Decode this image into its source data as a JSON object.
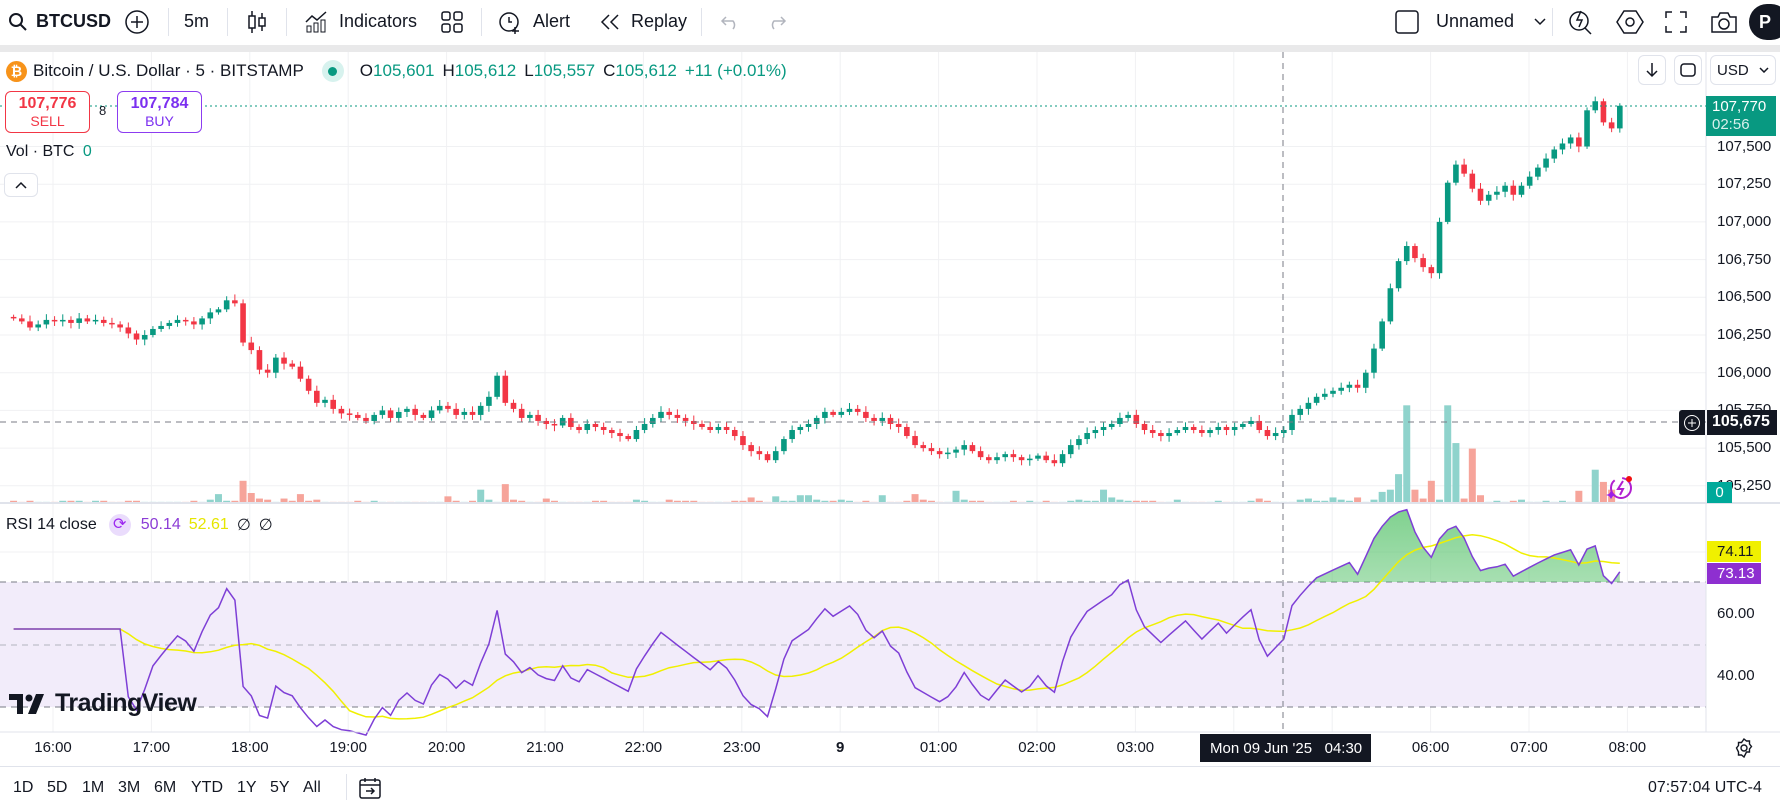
{
  "toolbar": {
    "symbol": "BTCUSD",
    "interval": "5m",
    "indicators": "Indicators",
    "alert": "Alert",
    "replay": "Replay",
    "layout_name": "Unnamed",
    "avatar": "P"
  },
  "legend": {
    "title": "Bitcoin / U.S. Dollar · 5 · BITSTAMP",
    "o_label": "O",
    "o": "105,601",
    "h_label": "H",
    "h": "105,612",
    "l_label": "L",
    "l": "105,557",
    "c_label": "C",
    "c": "105,612",
    "change": "+11 (+0.01%)"
  },
  "trade": {
    "sell_price": "107,776",
    "sell_label": "SELL",
    "spread": "8",
    "buy_price": "107,784",
    "buy_label": "BUY"
  },
  "volume_legend": {
    "label": "Vol · BTC",
    "value": "0"
  },
  "rsi_legend": {
    "label": "RSI 14 close",
    "rsi": "50.14",
    "ma": "52.61",
    "v1": "∅",
    "v2": "∅"
  },
  "price_axis": {
    "currency": "USD",
    "last_price": "107,770",
    "countdown": "02:56",
    "crosshair_price": "105,675",
    "volume_badge": "0",
    "ticks": [
      "107,500",
      "107,250",
      "107,000",
      "106,750",
      "106,500",
      "106,250",
      "106,000",
      "105,750",
      "105,500",
      "105,250"
    ]
  },
  "rsi_axis": {
    "ticks": [
      "60.00",
      "40.00"
    ],
    "ma_value": "74.11",
    "rsi_value": "73.13"
  },
  "time_axis": {
    "ticks": [
      "16:00",
      "17:00",
      "18:00",
      "19:00",
      "20:00",
      "21:00",
      "22:00",
      "23:00",
      "9",
      "01:00",
      "02:00",
      "03:00",
      "04:00",
      "05:00",
      "06:00",
      "07:00",
      "08:00"
    ],
    "crosshair_label": "Mon 09 Jun '25   04:30"
  },
  "ranges": [
    "1D",
    "5D",
    "1M",
    "3M",
    "6M",
    "YTD",
    "1Y",
    "5Y",
    "All"
  ],
  "clock": "07:57:04 UTC-4",
  "brand": "TradingView",
  "colors": {
    "up": "#089981",
    "down": "#f23645",
    "vol_up": "#8fd3cc",
    "vol_down": "#f6a49a",
    "rsi": "#7e3fd6",
    "rsi_ma": "#f0f000",
    "band": "#f2ecfa",
    "accent": "#2962ff"
  },
  "chart_data": {
    "type": "candlestick",
    "interval": "5m",
    "price_range": [
      105200,
      107850
    ],
    "first_label_time": "16:00",
    "closes": [
      106360,
      106340,
      106300,
      106320,
      106350,
      106340,
      106350,
      106330,
      106360,
      106340,
      106350,
      106330,
      106320,
      106300,
      106260,
      106220,
      106250,
      106290,
      106310,
      106330,
      106350,
      106340,
      106320,
      106360,
      106400,
      106420,
      106480,
      106460,
      106200,
      106150,
      106020,
      106000,
      106100,
      106060,
      106040,
      105960,
      105880,
      105800,
      105820,
      105760,
      105730,
      105720,
      105700,
      105680,
      105720,
      105750,
      105700,
      105740,
      105760,
      105720,
      105700,
      105750,
      105780,
      105760,
      105720,
      105740,
      105720,
      105780,
      105840,
      105980,
      105800,
      105760,
      105700,
      105720,
      105680,
      105660,
      105650,
      105700,
      105640,
      105620,
      105660,
      105640,
      105620,
      105600,
      105580,
      105560,
      105620,
      105660,
      105700,
      105740,
      105720,
      105700,
      105680,
      105660,
      105640,
      105620,
      105640,
      105620,
      105580,
      105520,
      105480,
      105460,
      105420,
      105480,
      105560,
      105620,
      105640,
      105660,
      105700,
      105740,
      105720,
      105740,
      105760,
      105740,
      105700,
      105680,
      105700,
      105660,
      105640,
      105580,
      105520,
      105500,
      105480,
      105460,
      105470,
      105490,
      105520,
      105480,
      105440,
      105420,
      105440,
      105460,
      105440,
      105420,
      105430,
      105450,
      105420,
      105400,
      105460,
      105520,
      105560,
      105600,
      105620,
      105640,
      105660,
      105700,
      105720,
      105660,
      105620,
      105600,
      105580,
      105600,
      105620,
      105640,
      105620,
      105600,
      105620,
      105640,
      105620,
      105640,
      105660,
      105680,
      105620,
      105580,
      105600,
      105620,
      105720,
      105760,
      105800,
      105840,
      105860,
      105880,
      105900,
      105920,
      105900,
      106000,
      106160,
      106340,
      106560,
      106740,
      106840,
      106760,
      106700,
      106660,
      107000,
      107260,
      107380,
      107320,
      107220,
      107140,
      107180,
      107200,
      107240,
      107180,
      107240,
      107300,
      107360,
      107420,
      107480,
      107520,
      107560,
      107500,
      107740,
      107800,
      107660,
      107620,
      107770
    ],
    "volumes": [
      2,
      1,
      2,
      1,
      1,
      1,
      2,
      2,
      2,
      1,
      2,
      2,
      1,
      1,
      2,
      2,
      1,
      1,
      1,
      1,
      1,
      1,
      2,
      1,
      3,
      8,
      2,
      2,
      20,
      9,
      4,
      3,
      1,
      4,
      2,
      8,
      2,
      3,
      1,
      1,
      1,
      1,
      2,
      1,
      2,
      1,
      1,
      1,
      1,
      1,
      1,
      1,
      1,
      6,
      2,
      1,
      2,
      12,
      3,
      1,
      17,
      3,
      2,
      1,
      1,
      4,
      2,
      1,
      1,
      1,
      1,
      2,
      2,
      1,
      1,
      1,
      3,
      2,
      1,
      1,
      3,
      2,
      2,
      2,
      1,
      1,
      1,
      1,
      2,
      2,
      5,
      2,
      1,
      6,
      2,
      2,
      7,
      7,
      3,
      2,
      2,
      3,
      2,
      1,
      2,
      1,
      7,
      1,
      1,
      2,
      8,
      3,
      2,
      1,
      1,
      11,
      3,
      2,
      2,
      1,
      1,
      1,
      2,
      1,
      2,
      1,
      2,
      1,
      1,
      2,
      3,
      2,
      2,
      12,
      5,
      3,
      2,
      2,
      2,
      2,
      1,
      1,
      3,
      1,
      1,
      1,
      1,
      2,
      1,
      1,
      1,
      2,
      4,
      2,
      1,
      1,
      1,
      3,
      4,
      2,
      2,
      5,
      3,
      2,
      5,
      1,
      3,
      10,
      12,
      26,
      88,
      12,
      4,
      20,
      3,
      88,
      54,
      4,
      49,
      7,
      1,
      2,
      1,
      2,
      3,
      1,
      1,
      2,
      1,
      2,
      1,
      11,
      1,
      30,
      19,
      12,
      1,
      2,
      3,
      2,
      13,
      16,
      3,
      1
    ],
    "indicators": [
      {
        "name": "RSI",
        "length": 14,
        "source": "close",
        "ma_length": 14,
        "bands": [
          70,
          50,
          30
        ]
      }
    ],
    "rsi_range": [
      20,
      90
    ]
  }
}
